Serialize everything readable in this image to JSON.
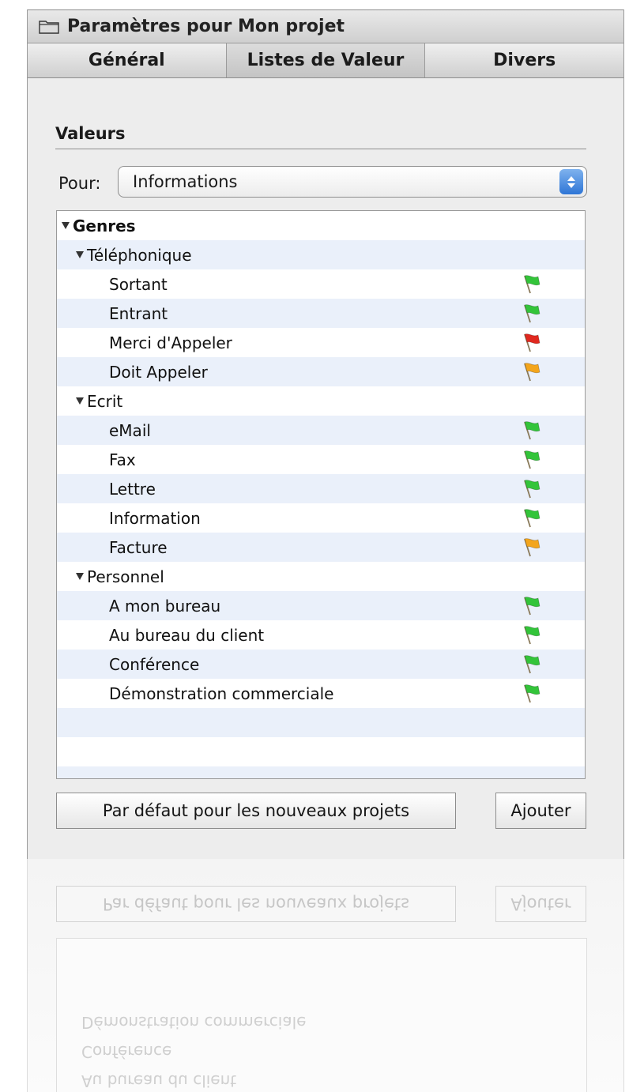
{
  "window": {
    "title": "Paramètres pour Mon projet",
    "tabs": [
      {
        "label": "Général"
      },
      {
        "label": "Listes de Valeur"
      },
      {
        "label": "Divers"
      }
    ]
  },
  "values_section": {
    "title": "Valeurs",
    "pour_label": "Pour:",
    "pour_value": "Informations"
  },
  "tree": [
    {
      "label": "Genres",
      "level": 0,
      "expanded": true,
      "flag": null
    },
    {
      "label": "Téléphonique",
      "level": 1,
      "expanded": true,
      "flag": null
    },
    {
      "label": "Sortant",
      "level": 2,
      "flag": "green"
    },
    {
      "label": "Entrant",
      "level": 2,
      "flag": "green"
    },
    {
      "label": "Merci d'Appeler",
      "level": 2,
      "flag": "red"
    },
    {
      "label": "Doit Appeler",
      "level": 2,
      "flag": "orange"
    },
    {
      "label": "Ecrit",
      "level": 1,
      "expanded": true,
      "flag": null
    },
    {
      "label": "eMail",
      "level": 2,
      "flag": "green"
    },
    {
      "label": "Fax",
      "level": 2,
      "flag": "green"
    },
    {
      "label": "Lettre",
      "level": 2,
      "flag": "green"
    },
    {
      "label": "Information",
      "level": 2,
      "flag": "green"
    },
    {
      "label": "Facture",
      "level": 2,
      "flag": "orange"
    },
    {
      "label": "Personnel",
      "level": 1,
      "expanded": true,
      "flag": null
    },
    {
      "label": "A mon bureau",
      "level": 2,
      "flag": "green"
    },
    {
      "label": "Au bureau du client",
      "level": 2,
      "flag": "green"
    },
    {
      "label": "Conférence",
      "level": 2,
      "flag": "green"
    },
    {
      "label": "Démonstration commerciale",
      "level": 2,
      "flag": "green"
    }
  ],
  "buttons": {
    "default_label": "Par défaut pour les nouveaux projets",
    "add_label": "Ajouter"
  },
  "colors": {
    "flag_green": "#33c43a",
    "flag_red": "#e0281f",
    "flag_orange": "#f3a51c",
    "selection_blue": "#3d82dc"
  }
}
